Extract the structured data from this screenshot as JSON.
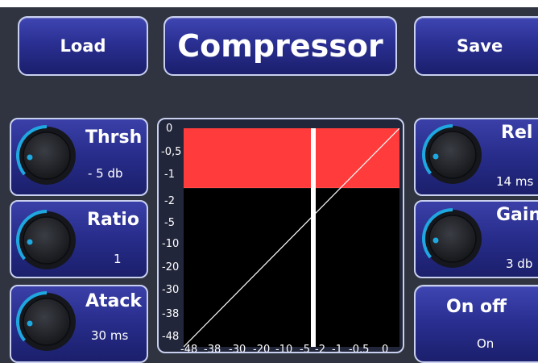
{
  "header": {
    "load_label": "Load",
    "title": "Compressor",
    "save_label": "Save"
  },
  "params": {
    "threshold": {
      "name": "Thrsh",
      "value": "- 5 db"
    },
    "ratio": {
      "name": "Ratio",
      "value": "1"
    },
    "attack": {
      "name": "Atack",
      "value": "30 ms"
    },
    "release": {
      "name": "Rel",
      "value": "14 ms"
    },
    "gain": {
      "name": "Gain",
      "value": "3 db"
    },
    "onoff": {
      "name": "On off",
      "value": "On"
    }
  },
  "graph": {
    "y_ticks": [
      "0",
      "-0,5",
      "-1",
      "-2",
      "-5",
      "-10",
      "-20",
      "-30",
      "-38",
      "-48"
    ],
    "x_ticks": [
      "-48",
      "-38",
      "-30",
      "-20",
      "-10",
      "-5",
      "-2",
      "-1",
      "-0,5",
      "0"
    ],
    "threshold_db": -5,
    "colors": {
      "zone": "#ff3b3b",
      "plot_bg": "#000000",
      "line": "#ffffff"
    }
  },
  "colors": {
    "background": "#2f3440",
    "button": "#2a2f92",
    "knob_arc": "#1fa7e0"
  }
}
